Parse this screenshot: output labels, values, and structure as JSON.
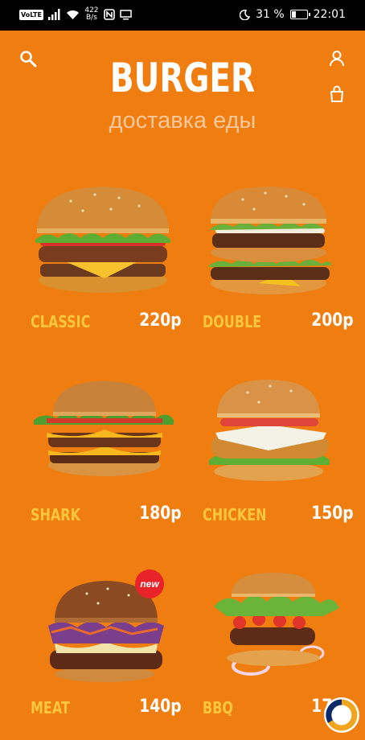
{
  "status_bar": {
    "volte": "VoLTE",
    "net_speed_value": "422",
    "net_speed_unit": "B/s",
    "battery_percent": "31 %",
    "battery_level": 0.31,
    "time": "22:01"
  },
  "header": {
    "brand": "BURGER",
    "subtitle": "доставка еды"
  },
  "colors": {
    "background": "#F07D10",
    "item_name": "#F9C63E",
    "price": "#FFFFFF",
    "badge": "#E8232A"
  },
  "menu": [
    {
      "name": "CLASSIC",
      "price": "220р"
    },
    {
      "name": "DOUBLE",
      "price": "200р"
    },
    {
      "name": "SHARK",
      "price": "180р"
    },
    {
      "name": "CHICKEN",
      "price": "150р"
    },
    {
      "name": "MEAT",
      "price": "140р",
      "badge": "new"
    },
    {
      "name": "BBQ",
      "price": "170р"
    }
  ]
}
